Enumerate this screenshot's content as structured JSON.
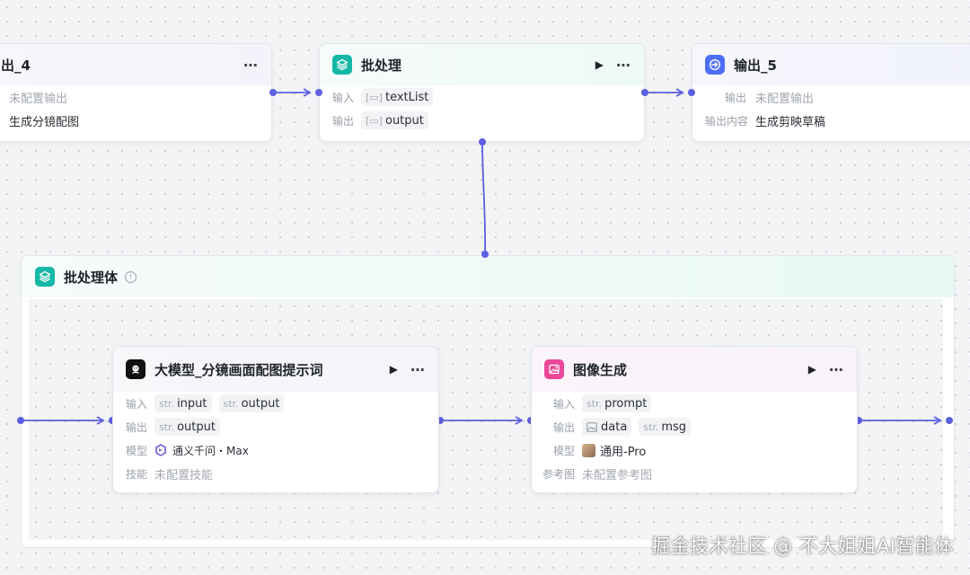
{
  "nodes": {
    "output4": {
      "title": "出_4",
      "row1_value": "未配置输出",
      "row2_value": "生成分镜配图"
    },
    "batch": {
      "title": "批处理",
      "input_label": "输入",
      "input_chip": "textList",
      "output_label": "输出",
      "output_chip": "output"
    },
    "output5": {
      "title": "输出_5",
      "output_label": "输出",
      "output_value": "未配置输出",
      "content_label": "输出内容",
      "content_value": "生成剪映草稿"
    }
  },
  "group": {
    "title": "批处理体",
    "info_glyph": "i"
  },
  "llm": {
    "title": "大模型_分镜画面配图提示词",
    "input_label": "输入",
    "input_chips": [
      {
        "type": "str.",
        "name": "input"
      },
      {
        "type": "str.",
        "name": "output"
      }
    ],
    "output_label": "输出",
    "output_chips": [
      {
        "type": "str.",
        "name": "output"
      }
    ],
    "model_label": "模型",
    "model_value": "通义千问・Max",
    "skill_label": "技能",
    "skill_value": "未配置技能"
  },
  "imagegen": {
    "title": "图像生成",
    "input_label": "输入",
    "input_chips": [
      {
        "type": "str.",
        "name": "prompt"
      }
    ],
    "output_label": "输出",
    "output_chips": [
      {
        "type": "",
        "name": "data"
      },
      {
        "type": "str.",
        "name": "msg"
      }
    ],
    "model_label": "模型",
    "model_value": "通用-Pro",
    "ref_label": "参考图",
    "ref_value": "未配置参考图"
  },
  "watermark": "掘金技术社区 @ 不大姐姐AI智能体",
  "colors": {
    "wire": "#5b5fe0",
    "teal_icon": "#14b8a6",
    "blue_icon": "#4f6ef7",
    "pink_icon": "#ec4899",
    "black_icon": "#111111"
  }
}
